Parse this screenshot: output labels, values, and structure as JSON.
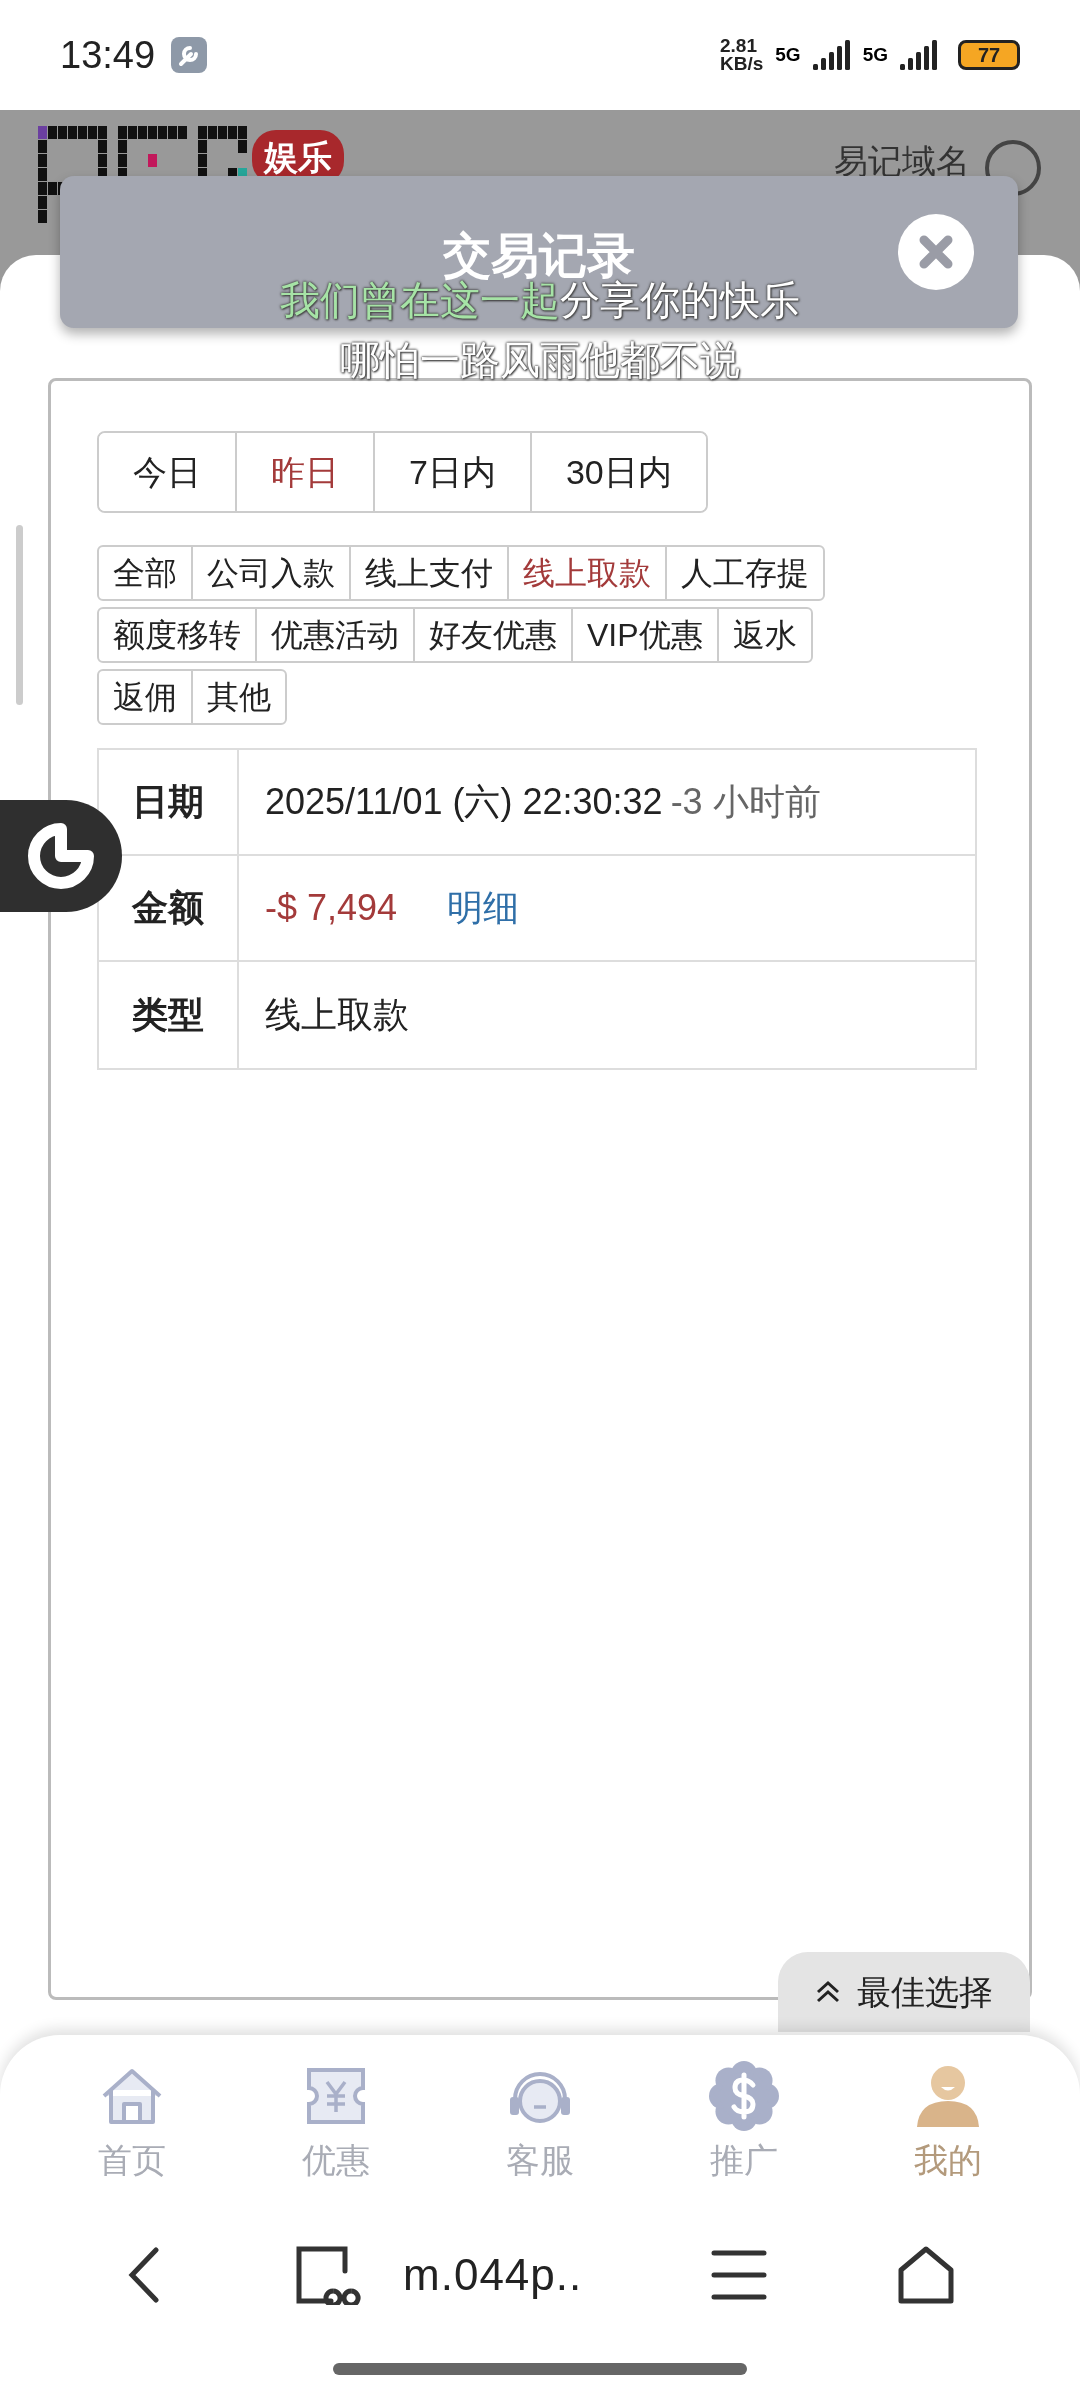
{
  "status_bar": {
    "time": "13:49",
    "speed_value": "2.81",
    "speed_unit": "KB/s",
    "network_1": "5G",
    "network_2": "5G",
    "battery": "77"
  },
  "header": {
    "brand_badge": "娱乐",
    "link": "易记域名"
  },
  "dialog": {
    "title": "交易记录"
  },
  "lyrics": [
    {
      "sung": "我们曾在这一起",
      "rest": "分享你的快乐"
    },
    {
      "rest": "哪怕一路风雨他都不说"
    }
  ],
  "date_tabs": [
    {
      "label": "今日",
      "selected": false
    },
    {
      "label": "昨日",
      "selected": true
    },
    {
      "label": "7日内",
      "selected": false
    },
    {
      "label": "30日内",
      "selected": false
    }
  ],
  "type_filters": [
    [
      {
        "label": "全部",
        "selected": false
      },
      {
        "label": "公司入款",
        "selected": false
      },
      {
        "label": "线上支付",
        "selected": false
      },
      {
        "label": "线上取款",
        "selected": true
      },
      {
        "label": "人工存提",
        "selected": false
      }
    ],
    [
      {
        "label": "额度移转",
        "selected": false
      },
      {
        "label": "优惠活动",
        "selected": false
      },
      {
        "label": "好友优惠",
        "selected": false
      },
      {
        "label": "VIP优惠",
        "selected": false
      },
      {
        "label": "返水",
        "selected": false
      }
    ],
    [
      {
        "label": "返佣",
        "selected": false
      },
      {
        "label": "其他",
        "selected": false
      }
    ]
  ],
  "record": {
    "date_label": "日期",
    "date": "2025/11/01 (六) 22:30:32",
    "relative_time": "-3 小时前",
    "amount_label": "金额",
    "amount": "-$ 7,494",
    "detail_link": "明细",
    "type_label": "类型",
    "type": "线上取款"
  },
  "float_button": "最佳选择",
  "bottom_nav": [
    {
      "label": "首页",
      "selected": false
    },
    {
      "label": "优惠",
      "selected": false
    },
    {
      "label": "客服",
      "selected": false
    },
    {
      "label": "推广",
      "selected": false
    },
    {
      "label": "我的",
      "selected": true
    }
  ],
  "browser": {
    "url": "m.044p.."
  }
}
